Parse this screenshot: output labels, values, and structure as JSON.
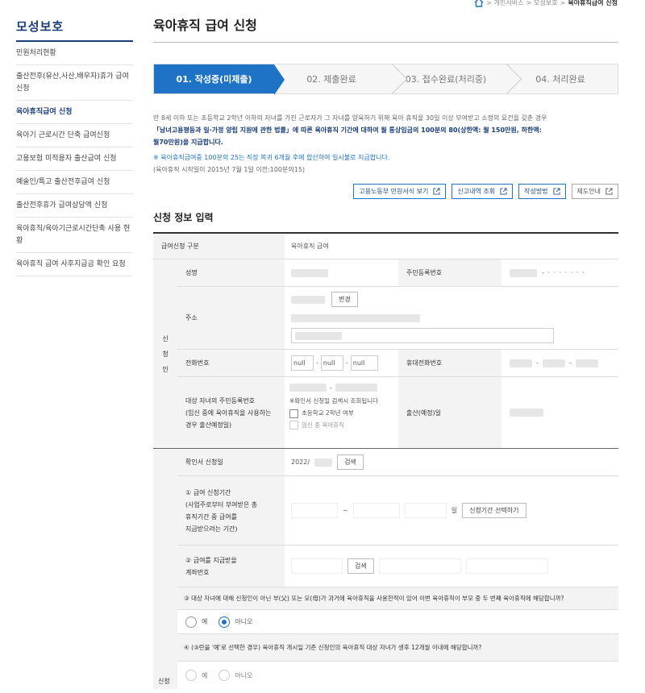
{
  "breadcrumb": {
    "items": [
      "개인서비스",
      "모성보호",
      "육아휴직급여 신청"
    ],
    "sep": ">"
  },
  "sidebar": {
    "title": "모성보호",
    "items": [
      {
        "label": "민원처리현황"
      },
      {
        "label": "출산전후(유산,사산,배우자)휴가 급여신청"
      },
      {
        "label": "육아휴직급여 신청"
      },
      {
        "label": "육아기 근로시간 단축 급여신청"
      },
      {
        "label": "고용보험 미적용자 출산급여 신청"
      },
      {
        "label": "예술인/특고 출산전후급여 신청"
      },
      {
        "label": "출산전후휴가 급여상당액 신청"
      },
      {
        "label": "육아휴직/육아기근로시간단축 사용 현황"
      },
      {
        "label": "육아휴직 급여 사후지급금 확인 요청"
      }
    ]
  },
  "page": {
    "title": "육아휴직 급여 신청"
  },
  "steps": [
    "01. 작성중(미제출)",
    "02. 제출완료",
    "03. 접수완료(처리중)",
    "04. 처리완료"
  ],
  "notice": {
    "line1": "만 8세 이하 또는 초등학교 2학년 이하의 자녀를 가진 근로자가 그 자녀를 양육하기 위해 육아 휴직을 30일 이상 부여받고 소정의 요건을 갖춘 경우",
    "line2_hl": "「남녀고용평등과 일·가정 양립 지원에 관한 법률」",
    "line2_rest": "에 따른 육아휴직 기간에 대하여 월 통상임금의 100분의 80(상한액: 월 150만원, 하한액:",
    "line3": "월70만원)을 지급합니다.",
    "sub1": "※ 육아휴직급여중 100분의 25는 직장 복귀 6개월 후에 합산하여 일시불로 지급합니다.",
    "sub2": "(육아휴직 시작일이 2015년 7월 1일 이전:100분의15)"
  },
  "buttons": {
    "form_view": "고용노동부 민원서식 보기",
    "history": "신고내역 조회",
    "how_to": "작성방법",
    "system_guide": "제도안내"
  },
  "section_title": "신청 정보 입력",
  "form": {
    "type_label": "급여신청 구분",
    "type_value": "육아휴직 급여",
    "applicant_group": [
      "신",
      "청",
      "인"
    ],
    "name_label": "성명",
    "rrn_label": "주민등록번호",
    "rrn_mask": "- · · · · · · ·",
    "address_label": "주소",
    "change_btn": "변경",
    "phone_label": "전화번호",
    "phone_parts": [
      "null",
      "null",
      "null"
    ],
    "mobile_label": "휴대전화번호",
    "child_rrn_label": [
      "대상 자녀의 주민등록번호",
      "(임신 중에 육아휴직을 사용하는",
      "경우 출산예정일)"
    ],
    "child_note": "※확인서 신청일 검색시 조회됩니다",
    "child_cb1": "초등학교 2학년 여부",
    "child_cb2": "임신 중 육아휴직",
    "due_label": "출산(예정)일",
    "confirm_label": "확인서 신청일",
    "confirm_value": "2022/",
    "search_btn": "검색",
    "period_label": [
      "① 급여 신청기간",
      "(사업주로부터 부여받은 총",
      "휴직기간 중 급여를",
      "지급받으려는 기간)"
    ],
    "period_sep": "~",
    "period_day": "일",
    "period_btn": "신청기간 선택하기",
    "account_label": [
      "② 급여를 지급받을",
      "계좌번호"
    ],
    "account_search": "검색",
    "q3": "③ 대상 자녀에 대해 신청인이 아닌 부(父) 또는 모(母)가 과거에 육아휴직을 사용한적이 있어 이번 육아휴직이 부모 중 두 번째 육아휴직에 해당합니까?",
    "yes": "예",
    "no": "아니오",
    "q4": "④ (③란을 '예'로 선택한 경우) 육아휴직 개시일 기준 신청인의 육아휴직 대상 자녀가 생후 12개월 이내에 해당합니까?",
    "bottom_group": "신청"
  }
}
